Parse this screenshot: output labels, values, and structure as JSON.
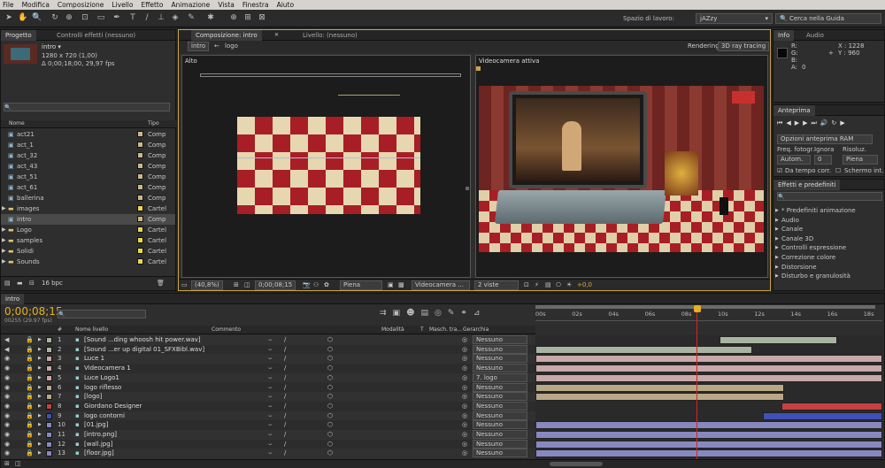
{
  "menu": [
    "File",
    "Modifica",
    "Composizione",
    "Livello",
    "Effetto",
    "Animazione",
    "Vista",
    "Finestra",
    "Aiuto"
  ],
  "toolbar": {
    "workspace_label": "Spazio di lavoro:",
    "workspace_value": "jAZzy",
    "search_placeholder": "Cerca nella Guida"
  },
  "project": {
    "tab_project": "Progetto",
    "tab_effects": "Controlli effetti (nessuno)",
    "selected_name": "intro ▾",
    "selected_size": "1280 x 720 (1,00)",
    "selected_duration": "Δ 0;00;18;00, 29,97 fps",
    "col_name": "Nome",
    "col_type": "Tipo",
    "items": [
      {
        "name": "act21",
        "type": "Comp",
        "color": "#c8b88a"
      },
      {
        "name": "act_1",
        "type": "Comp",
        "color": "#c8b88a"
      },
      {
        "name": "act_32",
        "type": "Comp",
        "color": "#c8b88a"
      },
      {
        "name": "act_43",
        "type": "Comp",
        "color": "#c8b88a"
      },
      {
        "name": "act_51",
        "type": "Comp",
        "color": "#c8b88a"
      },
      {
        "name": "act_61",
        "type": "Comp",
        "color": "#c8b88a"
      },
      {
        "name": "ballerina",
        "type": "Comp",
        "color": "#c8b88a"
      },
      {
        "name": "images",
        "type": "Cartel",
        "color": "#e8d84a"
      },
      {
        "name": "intro",
        "type": "Comp",
        "color": "#c8b88a"
      },
      {
        "name": "Logo",
        "type": "Cartel",
        "color": "#e8d84a"
      },
      {
        "name": "samples",
        "type": "Cartel",
        "color": "#e8d84a"
      },
      {
        "name": "Solidi",
        "type": "Cartel",
        "color": "#e8d84a"
      },
      {
        "name": "Sounds",
        "type": "Cartel",
        "color": "#e8d84a"
      }
    ],
    "bpc": "16 bpc"
  },
  "composition": {
    "tab_comp": "Composizione: intro",
    "tab_layer": "Livello: (nessuno)",
    "crumb1": "intro",
    "crumb2": "logo",
    "rendering_label": "Rendering:",
    "rendering_value": "3D ray tracing",
    "left_view": "Alto",
    "right_view": "Videocamera attiva",
    "zoom": "(40,8%)",
    "timecode": "0;00;08;15",
    "resolution": "Piena",
    "camera": "Videocamera ...",
    "views": "2 viste",
    "exposure": "+0,0"
  },
  "info": {
    "tab_info": "Info",
    "tab_audio": "Audio",
    "r": "R:",
    "g": "G:",
    "b": "B:",
    "a": "A:",
    "a_val": "0",
    "x": "X : 1228",
    "y": "Y : 960"
  },
  "preview": {
    "tab": "Anteprima",
    "ram": "Opzioni anteprima RAM",
    "freq_label": "Freq. fotogr.",
    "skip_label": "Ignora",
    "res_label": "Risoluz.",
    "freq_val": "Autom.",
    "skip_val": "0",
    "res_val": "Piena",
    "from_current": "Da tempo corr.",
    "fullscreen": "Schermo int."
  },
  "effects": {
    "tab": "Effetti e predefiniti",
    "search_placeholder": "",
    "items": [
      "* Predefiniti animazione",
      "Audio",
      "Canale",
      "Canale 3D",
      "Controlli espressione",
      "Correzione colore",
      "Distorsione",
      "Disturbo e granulosità"
    ]
  },
  "timeline": {
    "tab": "intro",
    "timecode": "0;00;08;15",
    "frames": "00255 (29.97 fps)",
    "col_num": "#",
    "col_name": "Nome livello",
    "col_comment": "Commento",
    "col_mode": "Modalità",
    "col_t": "T",
    "col_mask": "Masch. tra...",
    "col_parent": "Gerarchia",
    "ruler": [
      "00s",
      "02s",
      "04s",
      "06s",
      "08s",
      "10s",
      "12s",
      "14s",
      "16s",
      "18s"
    ],
    "layers": [
      {
        "num": "1",
        "name": "[Sound ...ding whoosh hit power.wav]",
        "color": "#a8b4a0",
        "parent": "Nessuno"
      },
      {
        "num": "2",
        "name": "[Sound ...er up digital 01_SFXBibl.wav]",
        "color": "#a8b4a0",
        "parent": "Nessuno"
      },
      {
        "num": "3",
        "name": "Luce 1",
        "color": "#c8a8a8",
        "parent": "Nessuno"
      },
      {
        "num": "4",
        "name": "Videocamera 1",
        "color": "#c8a8a8",
        "parent": "Nessuno"
      },
      {
        "num": "5",
        "name": "Luce Logo1",
        "color": "#c8a8a8",
        "parent": "7. logo"
      },
      {
        "num": "6",
        "name": "logo riflesso",
        "color": "#b8a888",
        "parent": "Nessuno"
      },
      {
        "num": "7",
        "name": "[logo]",
        "color": "#b8a888",
        "parent": "Nessuno"
      },
      {
        "num": "8",
        "name": "Giordano Designer",
        "color": "#c84040",
        "parent": "Nessuno"
      },
      {
        "num": "9",
        "name": "logo contorni",
        "color": "#4050b8",
        "parent": "Nessuno"
      },
      {
        "num": "10",
        "name": "[01.jpg]",
        "color": "#8888c0",
        "parent": "Nessuno"
      },
      {
        "num": "11",
        "name": "[intro.png]",
        "color": "#8888c0",
        "parent": "Nessuno"
      },
      {
        "num": "12",
        "name": "[wall.jpg]",
        "color": "#8888c0",
        "parent": "Nessuno"
      },
      {
        "num": "13",
        "name": "[floor.jpg]",
        "color": "#8888c0",
        "parent": "Nessuno"
      }
    ]
  }
}
